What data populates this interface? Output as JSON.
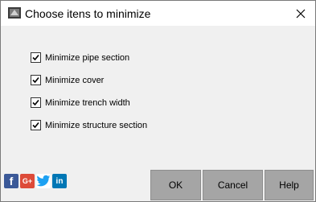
{
  "window": {
    "title": "Choose itens to minimize"
  },
  "options": [
    {
      "label": "Minimize pipe section",
      "checked": true
    },
    {
      "label": "Minimize cover",
      "checked": true
    },
    {
      "label": "Minimize trench width",
      "checked": true
    },
    {
      "label": "Minimize structure section",
      "checked": true
    }
  ],
  "social": {
    "facebook": "f",
    "googleplus": "G+",
    "linkedin": "in"
  },
  "buttons": {
    "ok": "OK",
    "cancel": "Cancel",
    "help": "Help"
  },
  "colors": {
    "button_bg": "#a5a5a5",
    "facebook": "#3b5998",
    "googleplus": "#dd4b39",
    "twitter": "#1da1f2",
    "linkedin": "#0077b5"
  }
}
